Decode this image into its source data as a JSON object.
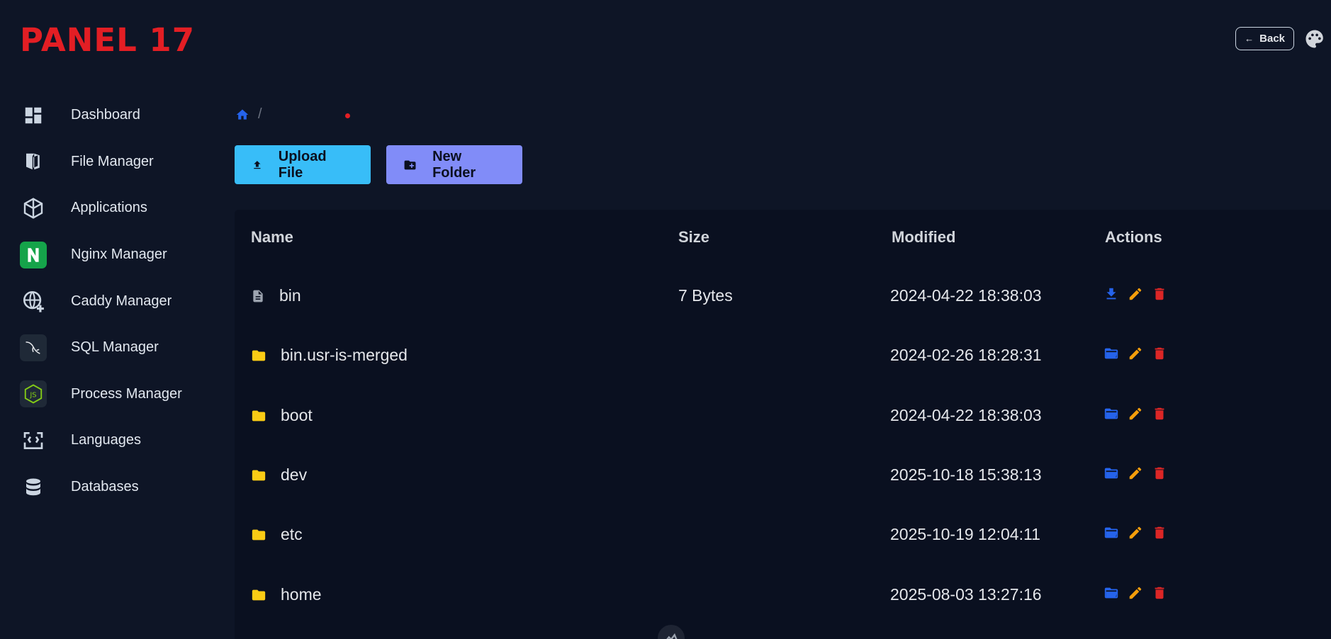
{
  "app": {
    "logo": "PANEL 17"
  },
  "header": {
    "back_label": "Back"
  },
  "sidebar": {
    "items": [
      {
        "label": "Dashboard",
        "icon": "dashboard-icon"
      },
      {
        "label": "File Manager",
        "icon": "file-manager-icon"
      },
      {
        "label": "Applications",
        "icon": "applications-icon"
      },
      {
        "label": "Nginx Manager",
        "icon": "nginx-icon"
      },
      {
        "label": "Caddy Manager",
        "icon": "caddy-globe-icon"
      },
      {
        "label": "SQL Manager",
        "icon": "mysql-dolphin-icon"
      },
      {
        "label": "Process Manager",
        "icon": "nodejs-icon"
      },
      {
        "label": "Languages",
        "icon": "code-brackets-icon"
      },
      {
        "label": "Databases",
        "icon": "database-icon"
      }
    ]
  },
  "breadcrumb": {
    "separator": "/"
  },
  "toolbar": {
    "upload_label": "Upload File",
    "new_folder_label": "New Folder"
  },
  "table": {
    "columns": {
      "name": "Name",
      "size": "Size",
      "modified": "Modified",
      "actions": "Actions"
    },
    "rows": [
      {
        "type": "file",
        "name": "bin",
        "size": "7 Bytes",
        "modified": "2024-04-22 18:38:03"
      },
      {
        "type": "folder",
        "name": "bin.usr-is-merged",
        "size": "",
        "modified": "2024-02-26 18:28:31"
      },
      {
        "type": "folder",
        "name": "boot",
        "size": "",
        "modified": "2024-04-22 18:38:03"
      },
      {
        "type": "folder",
        "name": "dev",
        "size": "",
        "modified": "2025-10-18 15:38:13"
      },
      {
        "type": "folder",
        "name": "etc",
        "size": "",
        "modified": "2025-10-19 12:04:11"
      },
      {
        "type": "folder",
        "name": "home",
        "size": "",
        "modified": "2025-08-03 13:27:16"
      }
    ]
  },
  "colors": {
    "brand": "#e31e24",
    "upload_button": "#38bdf8",
    "new_folder_button": "#818cf8",
    "folder_icon": "#facc15",
    "action_open": "#2563eb",
    "action_edit": "#f59e0b",
    "action_delete": "#dc2626"
  }
}
